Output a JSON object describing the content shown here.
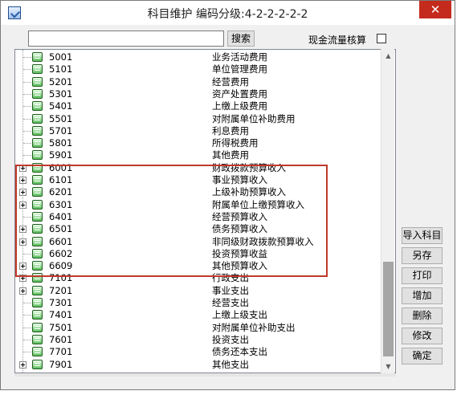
{
  "window": {
    "title": "科目维护  编码分级:4-2-2-2-2-2",
    "close_symbol": "✕"
  },
  "search": {
    "value": "",
    "button_label": "搜索"
  },
  "cash_flow": {
    "label": "现金流量核算",
    "checked": false
  },
  "tree": {
    "rows": [
      {
        "code": "5001",
        "name": "业务活动费用",
        "expandable": false
      },
      {
        "code": "5101",
        "name": "单位管理费用",
        "expandable": false
      },
      {
        "code": "5201",
        "name": "经营费用",
        "expandable": false
      },
      {
        "code": "5301",
        "name": "资产处置费用",
        "expandable": false
      },
      {
        "code": "5401",
        "name": "上缴上级费用",
        "expandable": false
      },
      {
        "code": "5501",
        "name": "对附属单位补助费用",
        "expandable": false
      },
      {
        "code": "5701",
        "name": "利息费用",
        "expandable": false
      },
      {
        "code": "5801",
        "name": "所得税费用",
        "expandable": false
      },
      {
        "code": "5901",
        "name": "其他费用",
        "expandable": false
      },
      {
        "code": "6001",
        "name": "财政拨款预算收入",
        "expandable": true
      },
      {
        "code": "6101",
        "name": "事业预算收入",
        "expandable": true
      },
      {
        "code": "6201",
        "name": "上级补助预算收入",
        "expandable": true
      },
      {
        "code": "6301",
        "name": "附属单位上缴预算收入",
        "expandable": true
      },
      {
        "code": "6401",
        "name": "经营预算收入",
        "expandable": false
      },
      {
        "code": "6501",
        "name": "债务预算收入",
        "expandable": true
      },
      {
        "code": "6601",
        "name": "非同级财政拨款预算收入",
        "expandable": true
      },
      {
        "code": "6602",
        "name": "投资预算收益",
        "expandable": false
      },
      {
        "code": "6609",
        "name": "其他预算收入",
        "expandable": true
      },
      {
        "code": "7101",
        "name": "行政支出",
        "expandable": true
      },
      {
        "code": "7201",
        "name": "事业支出",
        "expandable": true
      },
      {
        "code": "7301",
        "name": "经营支出",
        "expandable": false
      },
      {
        "code": "7401",
        "name": "上缴上级支出",
        "expandable": false
      },
      {
        "code": "7501",
        "name": "对附属单位补助支出",
        "expandable": false
      },
      {
        "code": "7601",
        "name": "投资支出",
        "expandable": false
      },
      {
        "code": "7701",
        "name": "债务还本支出",
        "expandable": false
      },
      {
        "code": "7901",
        "name": "其他支出",
        "expandable": true
      }
    ]
  },
  "buttons": {
    "import": "导入科目",
    "save": "另存",
    "print": "打印",
    "add": "增加",
    "delete": "删除",
    "edit": "修改",
    "confirm": "确定"
  },
  "colors": {
    "highlight_border": "#c0392b",
    "close_button": "#c42b1c"
  },
  "icons": {
    "app": "app-icon",
    "node": "account-node-icon",
    "expander": "plus-expander-icon"
  }
}
